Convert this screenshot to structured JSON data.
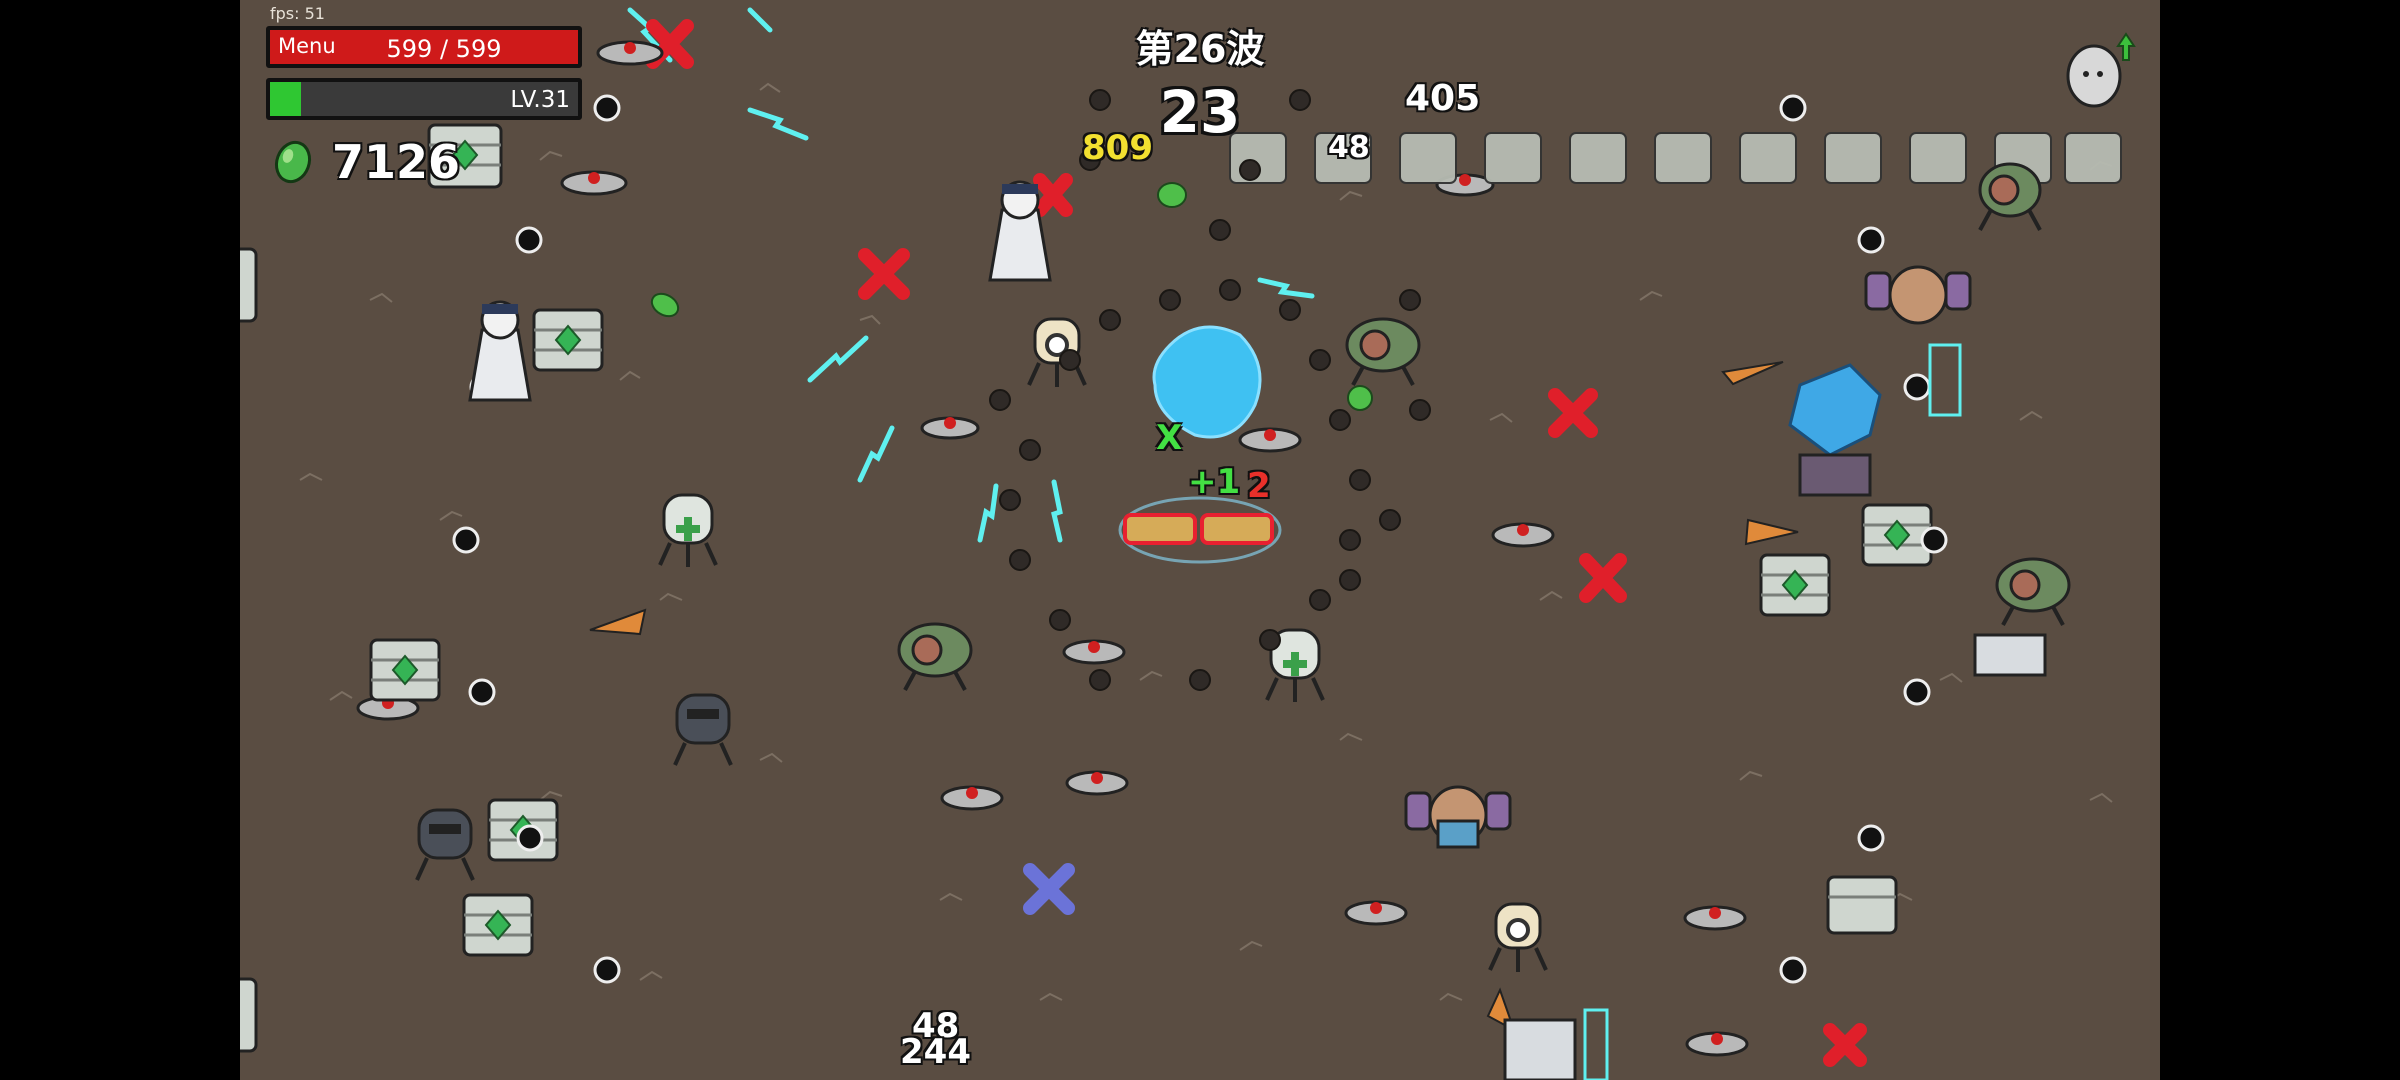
{
  "hud": {
    "fps": "fps: 51",
    "menu_label": "Menu",
    "hp_text": "599 / 599",
    "hp_fraction": 1.0,
    "level_text": "LV.31",
    "xp_fraction": 0.1,
    "materials": "7126",
    "wave_label": "第26波",
    "timer": "23"
  },
  "damage_numbers": [
    {
      "id": "dmg-405",
      "text": "405",
      "color": "#ffffff"
    },
    {
      "id": "dmg-809",
      "text": "809",
      "color": "#f2e030"
    },
    {
      "id": "dmg-48a",
      "text": "48",
      "color": "#ffffff"
    },
    {
      "id": "dmg-plus1",
      "text": "+1",
      "color": "#43e043"
    },
    {
      "id": "dmg-2",
      "text": "2",
      "color": "#e8302a"
    },
    {
      "id": "dmg-48b",
      "text": "48",
      "color": "#ffffff"
    },
    {
      "id": "dmg-244",
      "text": "244",
      "color": "#ffffff"
    },
    {
      "id": "dmg-x",
      "text": "X",
      "color": "#43e043"
    }
  ],
  "colors": {
    "ground": "#5a4d42",
    "hp_fill": "#cf1a1a",
    "xp_fill": "#2fc732",
    "lightning": "#5ff0f0",
    "enemy_x": "#e01f2a",
    "crate": "#cfd6cf",
    "crate_gem": "#35b455"
  },
  "icons": {
    "materials_icon": "green-material-icon",
    "levelup_icon": "egg-upgrade-icon"
  }
}
